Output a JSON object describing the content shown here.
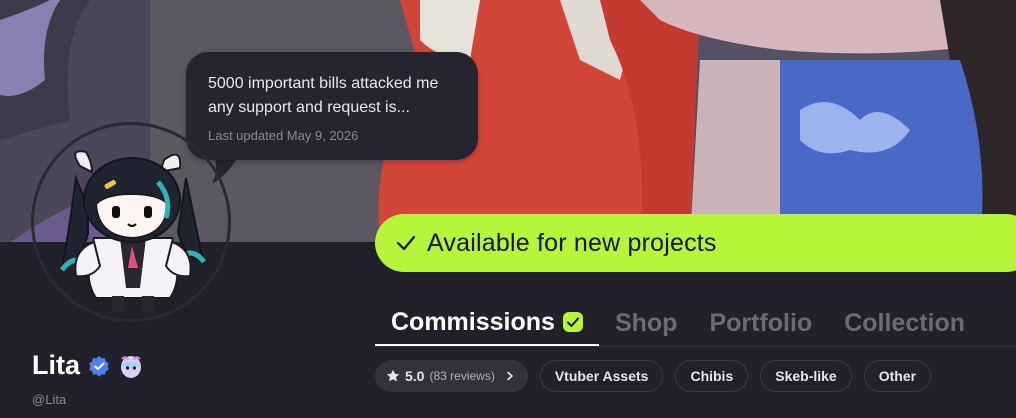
{
  "status": {
    "message": "5000 important bills attacked me any support and request is...",
    "updated": "Last updated May 9, 2026"
  },
  "availability": {
    "label": "Available for new projects",
    "color": "#b7f53a",
    "icon": "check-icon"
  },
  "profile": {
    "name": "Lita",
    "handle": "@Lita",
    "verified_icon": "verified-badge-icon",
    "extra_icon": "egg-badge-icon"
  },
  "tabs": [
    {
      "label": "Commissions",
      "active": true,
      "badge": "green-check-badge-icon"
    },
    {
      "label": "Shop",
      "active": false
    },
    {
      "label": "Portfolio",
      "active": false
    },
    {
      "label": "Collection",
      "active": false
    }
  ],
  "chips": {
    "rating": {
      "value": "5.0",
      "count": "(83 reviews)"
    },
    "tags": [
      "Vtuber Assets",
      "Chibis",
      "Skeb-like",
      "Other"
    ]
  }
}
